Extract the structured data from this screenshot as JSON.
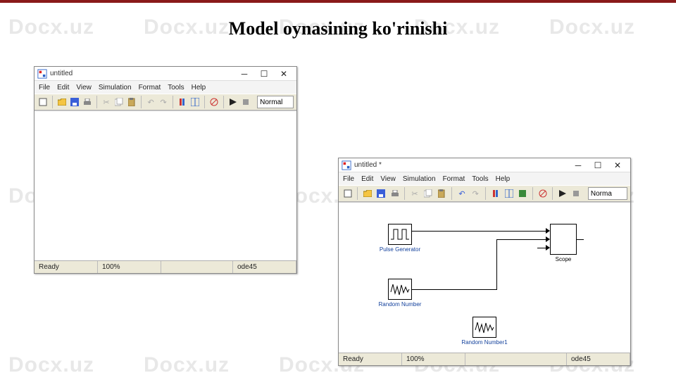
{
  "slide_title": "Model oynasining ko'rinishi",
  "watermark_text": "Docx.uz",
  "window1": {
    "title": "untitled",
    "menu": [
      "File",
      "Edit",
      "View",
      "Simulation",
      "Format",
      "Tools",
      "Help"
    ],
    "mode": "Normal",
    "status": {
      "ready": "Ready",
      "zoom": "100%",
      "solver": "ode45"
    }
  },
  "window2": {
    "title": "untitled *",
    "menu": [
      "File",
      "Edit",
      "View",
      "Simulation",
      "Format",
      "Tools",
      "Help"
    ],
    "mode": "Norma",
    "status": {
      "ready": "Ready",
      "zoom": "100%",
      "solver": "ode45"
    },
    "blocks": {
      "pulse": "Pulse Generator",
      "random1": "Random Number",
      "random2": "Random Number1",
      "scope": "Scope"
    }
  }
}
